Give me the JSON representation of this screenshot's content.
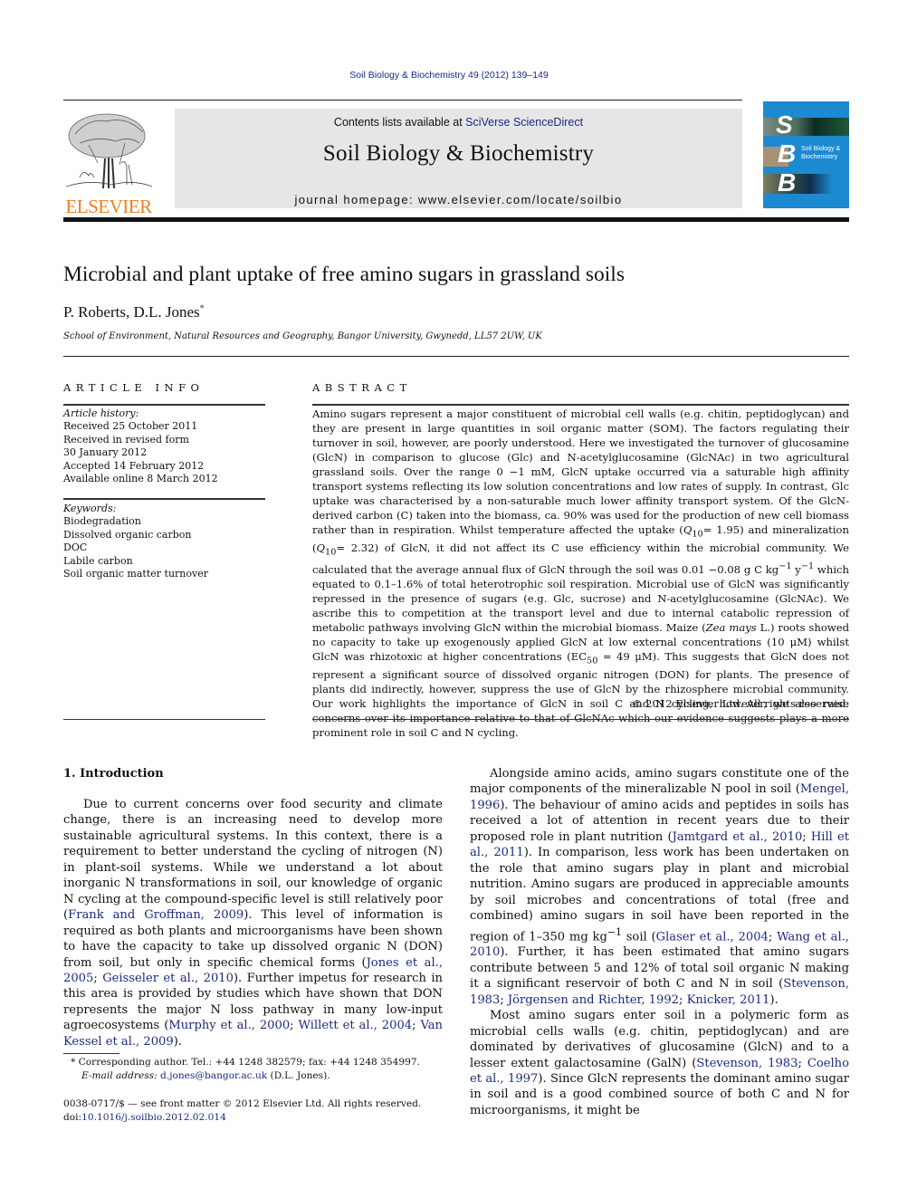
{
  "header": {
    "citation": "Soil Biology & Biochemistry 49 (2012) 139–149",
    "contents_prefix": "Contents lists available at ",
    "contents_link": "SciVerse ScienceDirect",
    "journal_title": "Soil Biology & Biochemistry",
    "homepage": "journal homepage: www.elsevier.com/locate/soilbio",
    "publisher_logo_text": "ELSEVIER",
    "cover_letters": [
      "S",
      "B",
      "B"
    ],
    "cover_title_line1": "Soil Biology &",
    "cover_title_line2": "Biochemistry"
  },
  "article": {
    "title": "Microbial and plant uptake of free amino sugars in grassland soils",
    "authors": "P. Roberts, D.L. Jones",
    "author_mark": "*",
    "affiliation": "School of Environment, Natural Resources and Geography, Bangor University, Gwynedd, LL57 2UW, UK"
  },
  "article_info": {
    "heading": "ARTICLE INFO",
    "history_label": "Article history:",
    "history": [
      "Received 25 October 2011",
      "Received in revised form",
      "30 January 2012",
      "Accepted 14 February 2012",
      "Available online 8 March 2012"
    ],
    "keywords_label": "Keywords:",
    "keywords": [
      "Biodegradation",
      "Dissolved organic carbon",
      "DOC",
      "Labile carbon",
      "Soil organic matter turnover"
    ]
  },
  "abstract": {
    "heading": "ABSTRACT",
    "p1": "Amino sugars represent a major constituent of microbial cell walls (e.g. chitin, peptidoglycan) and they are present in large quantities in soil organic matter (SOM). The factors regulating their turnover in soil, however, are poorly understood. Here we investigated the turnover of glucosamine (GlcN) in comparison to glucose (Glc) and N-acetylglucosamine (GlcNAc) in two agricultural grassland soils. Over the range 0 −1 mM, GlcN uptake occurred via a saturable high affinity transport systems reflecting its low solution concentrations and low rates of supply. In contrast, Glc uptake was characterised by a non-saturable much lower affinity transport system. Of the GlcN-derived carbon (C) taken into the biomass, ca. 90% was used for the production of new cell biomass rather than in respiration. Whilst temperature affected the uptake (",
    "q10a": "= 1.95) and mineralization (",
    "q10b": "= 2.32) of GlcN, it did not affect its C use efficiency within the microbial community. We calculated that the average annual flux of GlcN through the soil was 0.01 −0.08 g C kg",
    "flux_unit_mid": " y",
    "p2": " which equated to 0.1–1.6% of total heterotrophic soil respiration. Microbial use of GlcN was significantly repressed in the presence of sugars (e.g. Glc, sucrose) and N-acetylglucosamine (GlcNAc). We ascribe this to competition at the transport level and due to internal catabolic repression of metabolic pathways involving GlcN within the microbial biomass. Maize (",
    "species": "Zea mays",
    "p3": " L.) roots showed no capacity to take up exogenously applied GlcN at low external concentrations (10 μM) whilst GlcN was rhizotoxic at higher concentrations (EC",
    "p4": " = 49 μM). This suggests that GlcN does not represent a significant source of dissolved organic nitrogen (DON) for plants. The presence of plants did indirectly, however, suppress the use of GlcN by the rhizosphere microbial community. Our work highlights the importance of GlcN in soil C and N cycling, however, we also raise concerns over its importance relative to that of GlcNAc which our evidence suggests plays a more prominent role in soil C and N cycling.",
    "q_symbol": "Q",
    "q_sub": "10",
    "ec_sub": "50",
    "sup_neg1": "−1",
    "copyright": "© 2012 Elsevier Ltd. All rights reserved."
  },
  "introduction": {
    "heading": "1.  Introduction",
    "col1_p1_a": "Due to current concerns over food security and climate change, there is an increasing need to develop more sustainable agricultural systems. In this context, there is a requirement to better understand the cycling of nitrogen (N) in plant-soil systems. While we understand a lot about inorganic N transformations in soil, our knowledge of organic N cycling at the compound-specific level is still relatively poor (",
    "ref_frank": "Frank and Groffman, 2009",
    "col1_p1_b": "). This level of information is required as both plants and microorganisms have been shown to have the capacity to take up dissolved organic N (DON) from soil, but only in specific chemical forms (",
    "ref_jones": "Jones et al., 2005",
    "ref_geisseler": "Geisseler et al., 2010",
    "col1_p1_c": "). Further impetus for research in this area is provided by studies which have shown that DON represents the major N loss pathway in many low-input agroecosystems (",
    "ref_murphy": "Murphy et al., 2000",
    "ref_willett": "Willett et al., 2004",
    "ref_vankessel": "Van Kessel et al., 2009",
    "col2_p1_a": "Alongside amino acids, amino sugars constitute one of the major components of the mineralizable N pool in soil (",
    "ref_mengel": "Mengel, 1996",
    "col2_p1_b": "). The behaviour of amino acids and peptides in soils has received a lot of attention in recent years due to their proposed role in plant nutrition (",
    "ref_jamtgard": "Jamtgard et al., 2010",
    "ref_hill": "Hill et al., 2011",
    "col2_p1_c": "). In comparison, less work has been undertaken on the role that amino sugars play in plant and microbial nutrition. Amino sugars are produced in appreciable amounts by soil microbes and concentrations of total (free and combined) amino sugars in soil have been reported in the region of 1–350 mg kg",
    "col2_p1_d": " soil (",
    "ref_glaser": "Glaser et al., 2004",
    "ref_wang": "Wang et al., 2010",
    "col2_p1_e": "). Further, it has been estimated that amino sugars contribute between 5 and 12% of total soil organic N making it a significant reservoir of both C and N in soil (",
    "ref_stevenson": "Stevenson, 1983",
    "ref_jorgensen": "Jörgensen and Richter, 1992",
    "ref_knicker": "Knicker, 2011",
    "col2_p2_a": "Most amino sugars enter soil in a polymeric form as microbial cells walls (e.g. chitin, peptidoglycan) and are dominated by derivatives of glucosamine (GlcN) and to a lesser extent galactosamine (GalN) (",
    "ref_coelho": "Coelho et al., 1997",
    "col2_p2_b": "). Since GlcN represents the dominant amino sugar in soil and is a good combined source of both C and N for microorganisms, it might be",
    "sep": "; ",
    "close": ").",
    "close_plain": ")"
  },
  "footnote": {
    "mark": "*",
    "corresponding": " Corresponding author. Tel.: +44 1248 382579; fax: +44 1248 354997.",
    "email_label": "E-mail address: ",
    "email": "d.jones@bangor.ac.uk",
    "email_suffix": " (D.L. Jones).",
    "frontmatter": "0038-0717/$ — see front matter © 2012 Elsevier Ltd. All rights reserved.",
    "doi_label": "doi:",
    "doi": "10.1016/j.soilbio.2012.02.014"
  },
  "colors": {
    "link": "#1b2a80",
    "elsevier_orange": "#f07e1e",
    "cover_blue": "#1c8ad0",
    "banner_gray": "#e6e6e6"
  }
}
